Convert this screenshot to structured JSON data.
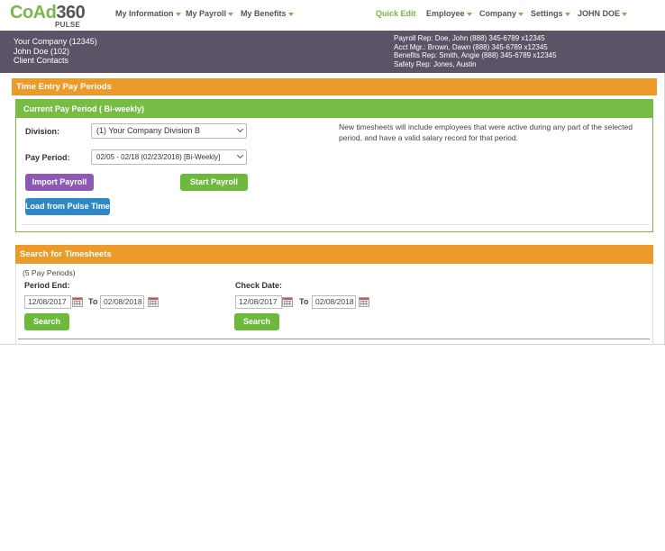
{
  "brand": {
    "logo_main_co": "CoAd",
    "logo_main_rest": "360",
    "logo_sub": "PULSE"
  },
  "nav": {
    "my_information": "My Information",
    "my_payroll": "My Payroll",
    "my_benefits": "My Benefits",
    "quick_edit": "Quick Edit",
    "employee": "Employee",
    "company": "Company",
    "settings": "Settings",
    "user": "JOHN DOE"
  },
  "info": {
    "company": "Your Company (12345)",
    "user": "John Doe (102)",
    "client_contacts": "Client Contacts",
    "payroll_rep": "Payroll Rep: Doe, John (888) 345-6789 x12345",
    "acct_mgr": "Acct Mgr.: Brown, Dawn (888) 345-6789 x12345",
    "benefits_rep": "Benefits Rep: Smith, Angie (888) 345-6789 x12345",
    "safety_rep": "Safety Rep: Jones, Austin"
  },
  "time_entry": {
    "title": "Time Entry Pay Periods",
    "current_period": {
      "title": "Current Pay Period ( Bi-weekly)",
      "division_label": "Division:",
      "division_value": "(1) Your Company Division B",
      "pay_period_label": "Pay Period:",
      "pay_period_value": "02/05 - 02/18 (02/23/2018) [Bi-Weekly]",
      "note": "New timesheets will include employees that were active during any part of the selected period, and have a valid salary record for that period.",
      "import_button": "Import Payroll",
      "start_button": "Start Payroll",
      "load_button": "Load from Pulse Time"
    }
  },
  "search": {
    "title": "Search for Timesheets",
    "count_text": "(5 Pay Periods)",
    "period_end_label": "Period End:",
    "period_end_from": "12/08/2017",
    "period_end_to": "02/08/2018",
    "check_date_label": "Check Date:",
    "check_date_from": "12/08/2017",
    "check_date_to": "02/08/2018",
    "to_label": "To",
    "search_button": "Search"
  },
  "colors": {
    "accent_green": "#76bc45",
    "accent_orange": "#ec9a2a",
    "info_bar": "#5c5466",
    "button_purple": "#8e59b5",
    "button_blue": "#2e88c8"
  },
  "icons": [
    "caret-down-icon",
    "chevron-down-icon",
    "calendar-icon"
  ]
}
